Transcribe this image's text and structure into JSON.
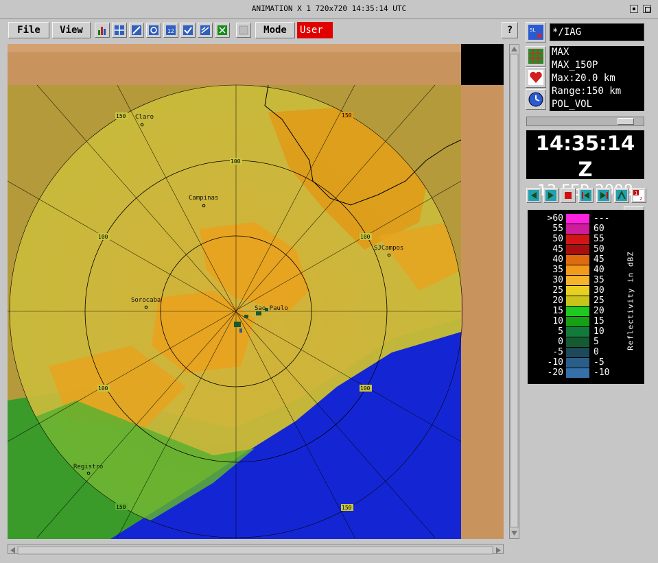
{
  "window": {
    "title": "ANIMATION  X 1  720x720   14:35:14 UTC"
  },
  "toolbar": {
    "file_label": "File",
    "view_label": "View",
    "mode_label": "Mode",
    "user_label": "User",
    "help_label": "?",
    "tool_icons": [
      "bar-chart-icon",
      "grid-icon",
      "zoom-icon",
      "refresh-icon",
      "split-icon",
      "overlay-icon",
      "cross-section-icon",
      "product-icon",
      "disabled-tool-icon"
    ]
  },
  "map": {
    "cities": [
      {
        "name": "Claro",
        "label": "Claro"
      },
      {
        "name": "Campinas",
        "label": "Campinas"
      },
      {
        "name": "SJCampos",
        "label": "SJCampos"
      },
      {
        "name": "Sorocaba",
        "label": "Sorocaba"
      },
      {
        "name": "Sao Paulo",
        "label": "Sao Paulo"
      },
      {
        "name": "Registro",
        "label": "Registro"
      }
    ],
    "ring_labels": [
      "150",
      "150",
      "100",
      "100",
      "100",
      "100",
      "100",
      "150",
      "150"
    ]
  },
  "panel": {
    "site": "*/IAG",
    "product_lines": [
      "MAX",
      "MAX_150P",
      "Max:20.0 km",
      "Range:150 km",
      "POL_VOL"
    ],
    "time": "14:35:14 Z",
    "date": "12 FEB 2008",
    "legend_unit": "Reflectivity in dBZ",
    "legend_rows": [
      {
        "left": ">60",
        "right": "---",
        "color": "#ff22dd"
      },
      {
        "left": "55",
        "right": "60",
        "color": "#cc1d9c"
      },
      {
        "left": "50",
        "right": "55",
        "color": "#d41515"
      },
      {
        "left": "45",
        "right": "50",
        "color": "#a80f0f"
      },
      {
        "left": "40",
        "right": "45",
        "color": "#e06a10"
      },
      {
        "left": "35",
        "right": "40",
        "color": "#f29a1a"
      },
      {
        "left": "30",
        "right": "35",
        "color": "#f5b42a"
      },
      {
        "left": "25",
        "right": "30",
        "color": "#e8d020"
      },
      {
        "left": "20",
        "right": "25",
        "color": "#c9c41a"
      },
      {
        "left": "15",
        "right": "20",
        "color": "#1ec81e"
      },
      {
        "left": "10",
        "right": "15",
        "color": "#16a016"
      },
      {
        "left": "5",
        "right": "10",
        "color": "#127a3a"
      },
      {
        "left": "0",
        "right": "5",
        "color": "#155a30"
      },
      {
        "left": "-5",
        "right": "0",
        "color": "#1c4a5a"
      },
      {
        "left": "-10",
        "right": "-5",
        "color": "#2a5e8a"
      },
      {
        "left": "-20",
        "right": "-10",
        "color": "#3670a8"
      }
    ]
  },
  "colors": {
    "land_low": "#c9c43e",
    "land_high": "#e8a21e",
    "ocean": "#1426d4",
    "background_terrain": "#c9935e"
  }
}
